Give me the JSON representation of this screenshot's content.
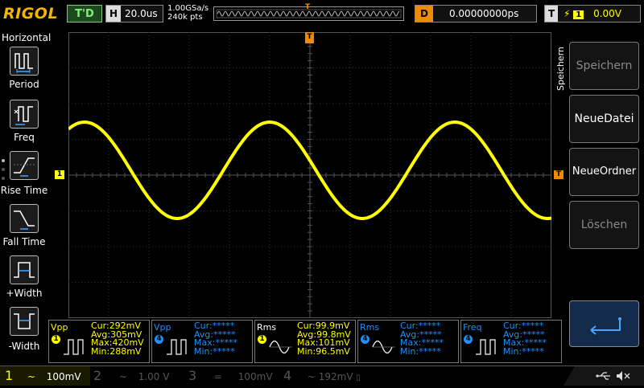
{
  "colors": {
    "ch1": "#ffff00",
    "ch2": "#00ffff",
    "ch3": "#ff00ff",
    "ch4": "#1e90ff",
    "accent": "#f08a00"
  },
  "top": {
    "logo": "RIGOL",
    "trigger_status": "T'D",
    "horizontal_key": "H",
    "timebase": "20.0us",
    "sample_rate": "1.00GSa/s",
    "memory_depth": "240k pts",
    "delay_key": "D",
    "delay_value": "0.00000000ps",
    "trigger_key": "T",
    "trigger_source": "1",
    "trigger_level": "0.00V"
  },
  "left_menu": {
    "title": "Horizontal",
    "items": [
      {
        "label": "Period",
        "icon": "period-icon"
      },
      {
        "label": "Freq",
        "icon": "frequency-icon"
      },
      {
        "label": "Rise Time",
        "icon": "rise-time-icon"
      },
      {
        "label": "Fall Time",
        "icon": "fall-time-icon"
      },
      {
        "label": "+Width",
        "icon": "positive-width-icon"
      },
      {
        "label": "-Width",
        "icon": "negative-width-icon"
      }
    ]
  },
  "right_menu": {
    "header": "Speichern",
    "buttons": [
      {
        "label": "Speichern",
        "enabled": false
      },
      {
        "label": "NeueDatei",
        "enabled": true
      },
      {
        "label": "NeueOrdner",
        "enabled": true
      },
      {
        "label": "Löschen",
        "enabled": false
      }
    ],
    "return_icon": "return-arrow-icon"
  },
  "markers": {
    "trigger_top": "T",
    "ch1_offset": "1",
    "trigger_level": "T"
  },
  "measurements": [
    {
      "name": "Vpp",
      "channel": "1",
      "lines": [
        "Cur:292mV",
        "Avg:305mV",
        "Max:420mV",
        "Min:288mV"
      ]
    },
    {
      "name": "Vpp",
      "channel": "4",
      "lines": [
        "Cur:*****",
        "Avg:*****",
        "Max:*****",
        "Min:*****"
      ]
    },
    {
      "name": "Rms",
      "channel": "1",
      "lines": [
        "Cur:99.9mV",
        "Avg:99.8mV",
        "Max:101mV",
        "Min:96.5mV"
      ]
    },
    {
      "name": "Rms",
      "channel": "4",
      "lines": [
        "Cur:*****",
        "Avg:*****",
        "Max:*****",
        "Min:*****"
      ]
    },
    {
      "name": "Freq",
      "channel": "4",
      "lines": [
        "Cur:*****",
        "Avg:*****",
        "Max:*****",
        "Min:*****"
      ]
    }
  ],
  "channels": [
    {
      "num": "1",
      "coupling": "~",
      "scale": "100mV"
    },
    {
      "num": "2",
      "coupling": "~",
      "scale": "1.00 V"
    },
    {
      "num": "3",
      "coupling": "=",
      "scale": "100mV"
    },
    {
      "num": "4",
      "coupling": "~",
      "scale": "192mV"
    }
  ],
  "status_icons": [
    "usb-icon",
    "sound-muted-icon"
  ]
}
